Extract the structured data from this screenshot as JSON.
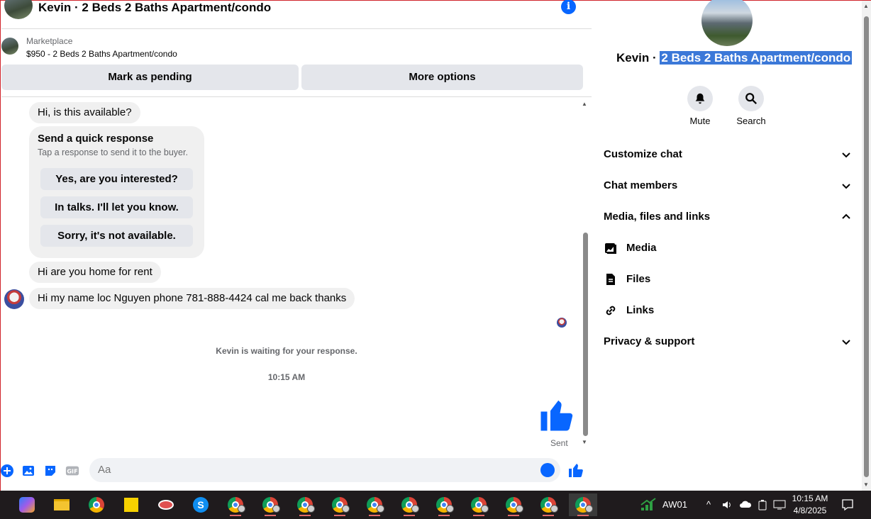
{
  "header": {
    "title": "Kevin · 2 Beds 2 Baths Apartment/condo",
    "info_icon": "info-icon"
  },
  "marketplace": {
    "label": "Marketplace",
    "listing": "$950 - 2 Beds 2 Baths Apartment/condo",
    "pending_button": "Mark as pending",
    "more_button": "More options"
  },
  "messages": {
    "m1": "Hi, is this available?",
    "quick_title": "Send a quick response",
    "quick_sub": "Tap a response to send it to the buyer.",
    "quick_options": [
      "Yes, are you interested?",
      "In talks. I'll let you know.",
      "Sorry, it's not available."
    ],
    "m2": "Hi are you home for rent",
    "m3": "Hi my name loc Nguyen phone 781-888-4424 cal me back thanks",
    "waiting": "Kevin is waiting for your response.",
    "time": "10:15 AM",
    "sent": "Sent"
  },
  "composer": {
    "placeholder": "Aa"
  },
  "info_pane": {
    "name_prefix": "Kevin · ",
    "name_selected": "2 Beds 2 Baths Apartment/condo",
    "mute": "Mute",
    "search": "Search",
    "sections": {
      "customize": "Customize chat",
      "members": "Chat members",
      "media_files_links": "Media, files and links",
      "privacy": "Privacy & support"
    },
    "subitems": {
      "media": "Media",
      "files": "Files",
      "links": "Links"
    }
  },
  "taskbar": {
    "network_label": "AW01",
    "clock_time": "10:15 AM",
    "clock_date": "4/8/2025"
  },
  "colors": {
    "accent": "#0866ff",
    "selection": "#3b78d8",
    "bubble": "#f0f0f0",
    "button": "#e4e6eb"
  }
}
